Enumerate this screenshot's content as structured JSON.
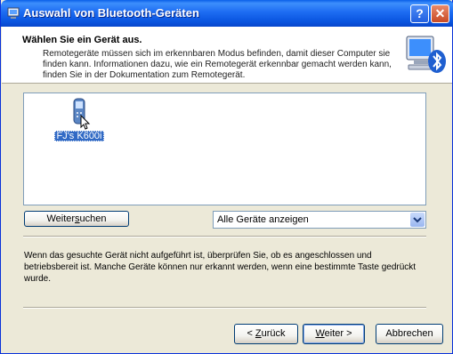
{
  "window": {
    "title": "Auswahl von Bluetooth-Geräten",
    "help_label": "?",
    "close_label": "✕"
  },
  "header": {
    "title": "Wählen Sie ein Gerät aus.",
    "description": "Remotegeräte müssen sich im erkennbaren Modus befinden, damit dieser Computer sie finden kann. Informationen dazu, wie ein Remotegerät erkennbar gemacht werden kann, finden Sie in der Dokumentation zum Remotegerät."
  },
  "devices": [
    {
      "name": "FJ's K600i",
      "icon": "phone-icon",
      "selected": true
    }
  ],
  "search_button": {
    "label_pre": "Weiter",
    "label_ul": "s",
    "label_post": "uchen"
  },
  "filter": {
    "selected": "Alle Geräte anzeigen"
  },
  "info_text": "Wenn das gesuchte Gerät nicht aufgeführt ist, überprüfen Sie, ob es angeschlossen und betriebsbereit ist. Manche Geräte können nur erkannt werden, wenn eine bestimmte Taste gedrückt wurde.",
  "buttons": {
    "back": {
      "pre": "< ",
      "ul": "Z",
      "post": "urück"
    },
    "next": {
      "pre": "",
      "ul": "W",
      "post": "eiter >"
    },
    "cancel": {
      "label": "Abbrechen"
    }
  },
  "colors": {
    "title_bar": "#0a55e0",
    "selection": "#316ac5",
    "dialog_bg": "#ece9d8"
  }
}
